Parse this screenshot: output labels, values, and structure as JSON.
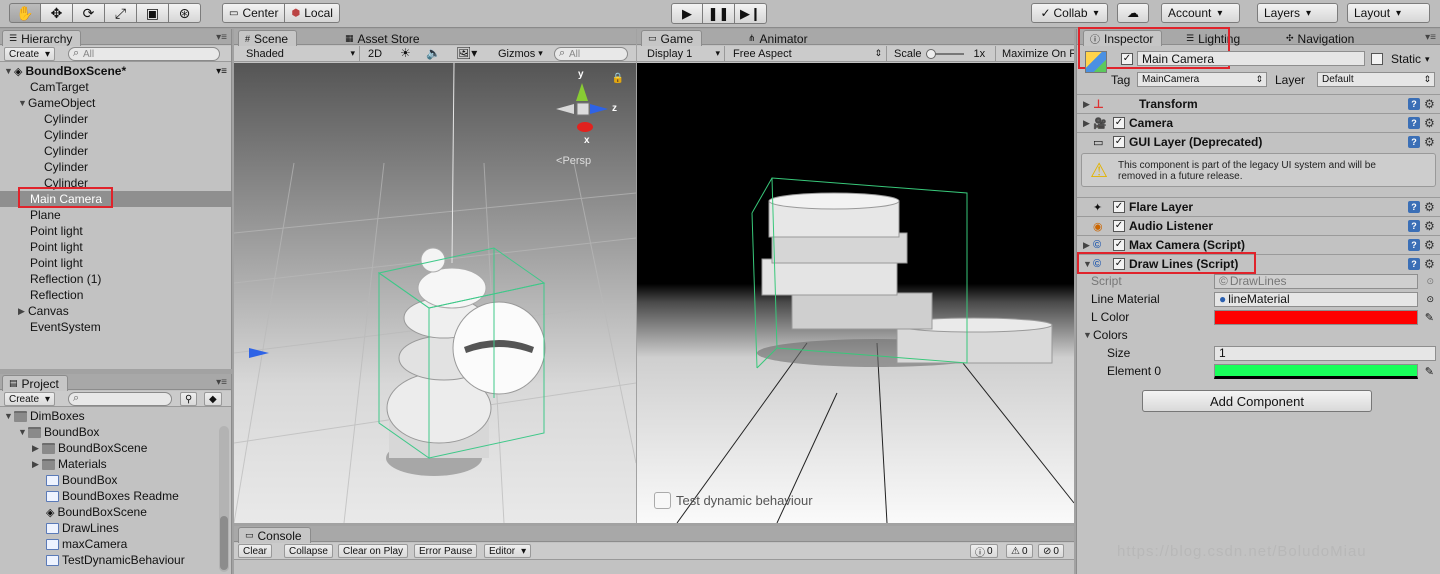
{
  "toolbar": {
    "pivot_center": "Center",
    "pivot_local": "Local",
    "collab": "Collab",
    "account": "Account",
    "layers": "Layers",
    "layout": "Layout"
  },
  "hierarchy": {
    "tab": "Hierarchy",
    "create": "Create",
    "search_placeholder": "All",
    "scene_name": "BoundBoxScene*",
    "items": [
      {
        "label": "CamTarget"
      },
      {
        "label": "GameObject"
      },
      {
        "label": "Cylinder"
      },
      {
        "label": "Cylinder"
      },
      {
        "label": "Cylinder"
      },
      {
        "label": "Cylinder"
      },
      {
        "label": "Cylinder"
      },
      {
        "label": "Main Camera"
      },
      {
        "label": "Plane"
      },
      {
        "label": "Point light"
      },
      {
        "label": "Point light"
      },
      {
        "label": "Point light"
      },
      {
        "label": "Reflection (1)"
      },
      {
        "label": "Reflection"
      },
      {
        "label": "Canvas"
      },
      {
        "label": "EventSystem"
      }
    ]
  },
  "project": {
    "tab": "Project",
    "create": "Create",
    "items": [
      {
        "label": "DimBoxes"
      },
      {
        "label": "BoundBox"
      },
      {
        "label": "BoundBoxScene"
      },
      {
        "label": "Materials"
      },
      {
        "label": "BoundBox"
      },
      {
        "label": "BoundBoxes Readme"
      },
      {
        "label": "BoundBoxScene"
      },
      {
        "label": "DrawLines"
      },
      {
        "label": "maxCamera"
      },
      {
        "label": "TestDynamicBehaviour"
      }
    ]
  },
  "scene": {
    "tab": "Scene",
    "tab2": "Asset Store",
    "shading": "Shaded",
    "mode2d": "2D",
    "gizmos": "Gizmos",
    "search_placeholder": "All",
    "persp": "Persp",
    "axis_x": "x",
    "axis_y": "y",
    "axis_z": "z"
  },
  "game": {
    "tab": "Game",
    "tab2": "Animator",
    "display": "Display 1",
    "aspect": "Free Aspect",
    "scale_label": "Scale",
    "scale_value": "1x",
    "maximize": "Maximize On P",
    "toggle_label": "Test dynamic behaviour"
  },
  "console": {
    "tab": "Console",
    "clear": "Clear",
    "collapse": "Collapse",
    "clear_on_play": "Clear on Play",
    "error_pause": "Error Pause",
    "editor": "Editor",
    "count_info": "0",
    "count_warn": "0",
    "count_error": "0"
  },
  "inspector": {
    "tab": "Inspector",
    "tab_lighting": "Lighting",
    "tab_navigation": "Navigation",
    "object_name": "Main Camera",
    "static_label": "Static",
    "tag_label": "Tag",
    "tag_value": "MainCamera",
    "layer_label": "Layer",
    "layer_value": "Default",
    "components": [
      {
        "label": "Transform"
      },
      {
        "label": "Camera"
      },
      {
        "label": "GUI Layer (Deprecated)"
      },
      {
        "label": "Flare Layer"
      },
      {
        "label": "Audio Listener"
      },
      {
        "label": "Max Camera (Script)"
      },
      {
        "label": "Draw Lines (Script)"
      }
    ],
    "warning_line1": "This component is part of the legacy UI system and will be",
    "warning_line2": "removed in a future release.",
    "fields": {
      "script_label": "Script",
      "script_value": "DrawLines",
      "line_material_label": "Line Material",
      "line_material_value": "lineMaterial",
      "lcolor_label": "L Color",
      "colors_label": "Colors",
      "size_label": "Size",
      "size_value": "1",
      "element0_label": "Element 0"
    },
    "lcolor_hex": "#ff0000",
    "element0_hex": "#19ff5a",
    "add_component": "Add Component"
  },
  "watermark": "https://blog.csdn.net/BoludoMiau"
}
